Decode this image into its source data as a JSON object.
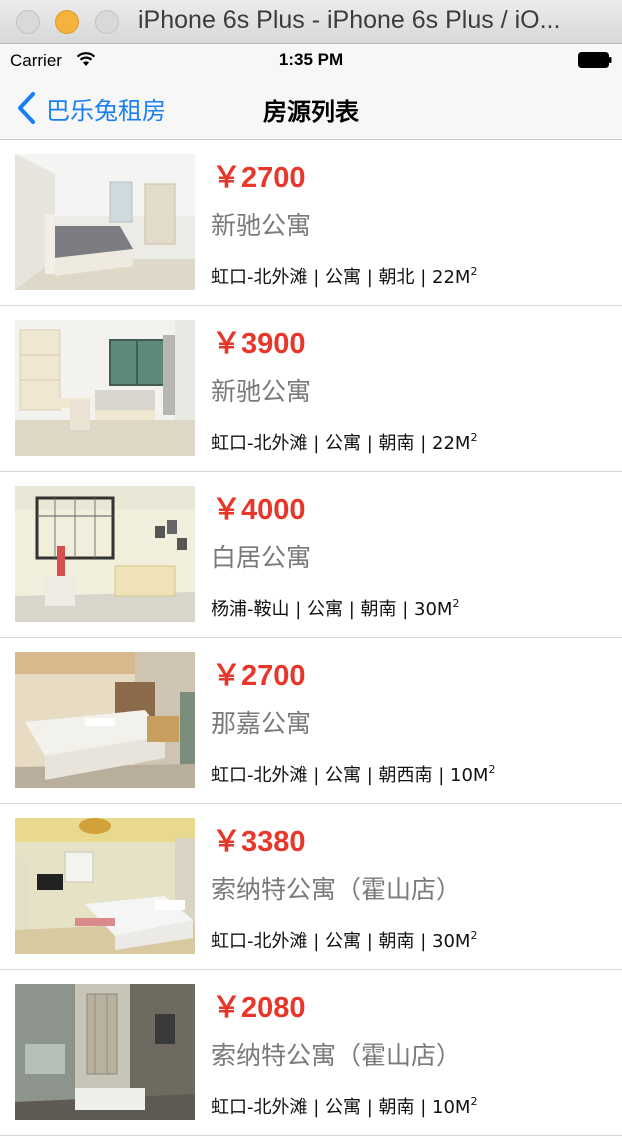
{
  "window": {
    "title": "iPhone 6s Plus - iPhone 6s Plus / iO..."
  },
  "status_bar": {
    "carrier": "Carrier",
    "time": "1:35 PM"
  },
  "nav": {
    "back_label": "巴乐兔租房",
    "title": "房源列表"
  },
  "listings": [
    {
      "price": "￥2700",
      "name": "新驰公寓",
      "details": "虹口-北外滩 | 公寓 | 朝北 | 22M",
      "unit_sup": "2",
      "photo": "bedroom-grey-bed"
    },
    {
      "price": "￥3900",
      "name": "新驰公寓",
      "details": "虹口-北外滩 | 公寓 | 朝南 | 22M",
      "unit_sup": "2",
      "photo": "bedroom-desk-window"
    },
    {
      "price": "￥4000",
      "name": "白居公寓",
      "details": "杨浦-鞍山 | 公寓 | 朝南 | 30M",
      "unit_sup": "2",
      "photo": "loft-sofa"
    },
    {
      "price": "￥2700",
      "name": "那嘉公寓",
      "details": "虹口-北外滩 | 公寓 | 朝西南 | 10M",
      "unit_sup": "2",
      "photo": "bedroom-white-bed"
    },
    {
      "price": "￥3380",
      "name": "索纳特公寓（霍山店）",
      "details": "虹口-北外滩 | 公寓 | 朝南 | 30M",
      "unit_sup": "2",
      "photo": "bedroom-tv"
    },
    {
      "price": "￥2080",
      "name": "索纳特公寓（霍山店）",
      "details": "虹口-北外滩 | 公寓 | 朝南 | 10M",
      "unit_sup": "2",
      "photo": "bathroom-glass"
    }
  ],
  "colors": {
    "price": "#e8372a",
    "accent": "#1a7ff5",
    "name": "#7a7a7a"
  }
}
